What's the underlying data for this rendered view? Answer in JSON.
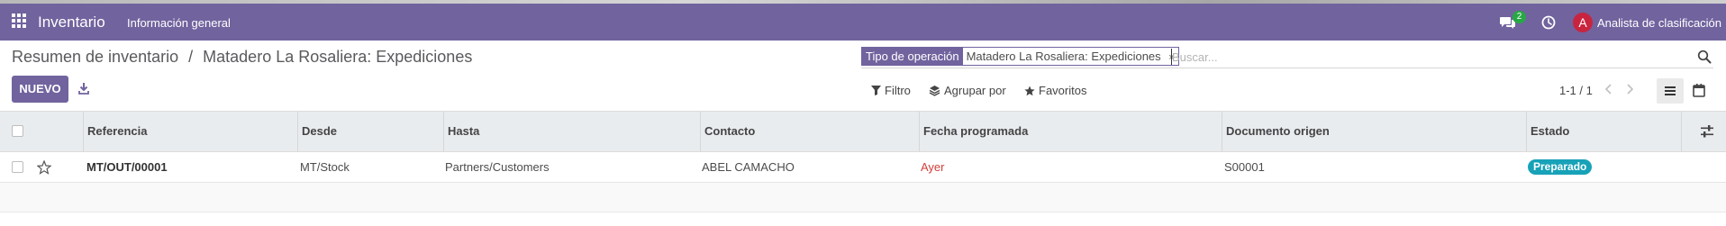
{
  "navbar": {
    "app_name": "Inventario",
    "menu": [
      "Información general"
    ],
    "chat_count": "2",
    "user_initial": "A",
    "user_name": "Analista de clasificación",
    "colors": {
      "primary": "#71639e",
      "badge": "#28a745",
      "avatar": "#c9243f"
    }
  },
  "breadcrumb": {
    "parent": "Resumen de inventario",
    "separator": "/",
    "current": "Matadero La Rosaliera: Expediciones"
  },
  "search": {
    "facet_label": "Tipo de operación",
    "facet_value": "Matadero La Rosaliera: Expediciones",
    "facet_remove": "×",
    "placeholder": "Buscar...",
    "value": ""
  },
  "toolbar": {
    "new_label": "NUEVO",
    "filter_label": "Filtro",
    "groupby_label": "Agrupar por",
    "favorites_label": "Favoritos",
    "pager": "1-1 / 1",
    "views": [
      "list-view-icon",
      "calendar-view-icon"
    ],
    "active_view": "list-view-icon"
  },
  "table": {
    "columns": [
      "Referencia",
      "Desde",
      "Hasta",
      "Contacto",
      "Fecha programada",
      "Documento origen",
      "Estado"
    ],
    "rows": [
      {
        "reference": "MT/OUT/00001",
        "from": "MT/Stock",
        "to": "Partners/Customers",
        "contact": "ABEL CAMACHO",
        "scheduled": "Ayer",
        "origin": "S00001",
        "state": "Preparado",
        "state_color": "#17a2b8",
        "scheduled_color": "#d23f3a"
      }
    ]
  }
}
